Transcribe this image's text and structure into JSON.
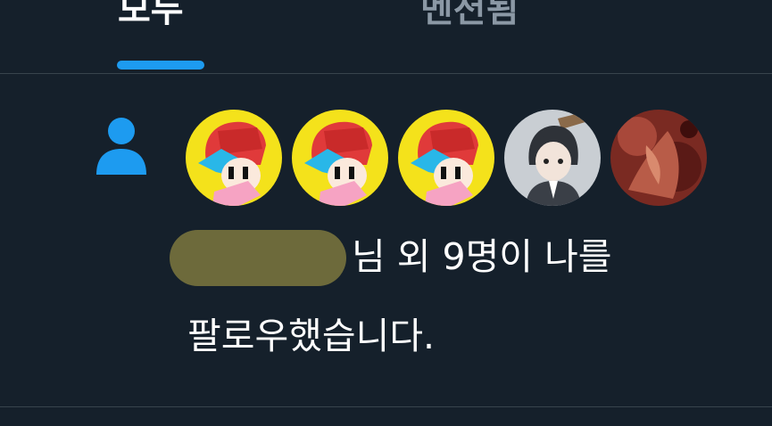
{
  "tabs": [
    {
      "label": "모두",
      "active": true
    },
    {
      "label": "멘션됨",
      "active": false
    },
    {
      "label": "",
      "active": false
    }
  ],
  "notification": {
    "icon": "person-icon",
    "avatars": [
      "fnf-boyfriend-avatar",
      "fnf-boyfriend-avatar",
      "fnf-boyfriend-avatar",
      "anime-boy-avatar",
      "red-artwork-avatar"
    ],
    "line1": "님 외 9명이 나를",
    "line2": "팔로우했습니다."
  },
  "colors": {
    "background": "#15202b",
    "accent": "#1d9bf0",
    "divider": "#38444d",
    "muted": "#8b98a5"
  }
}
